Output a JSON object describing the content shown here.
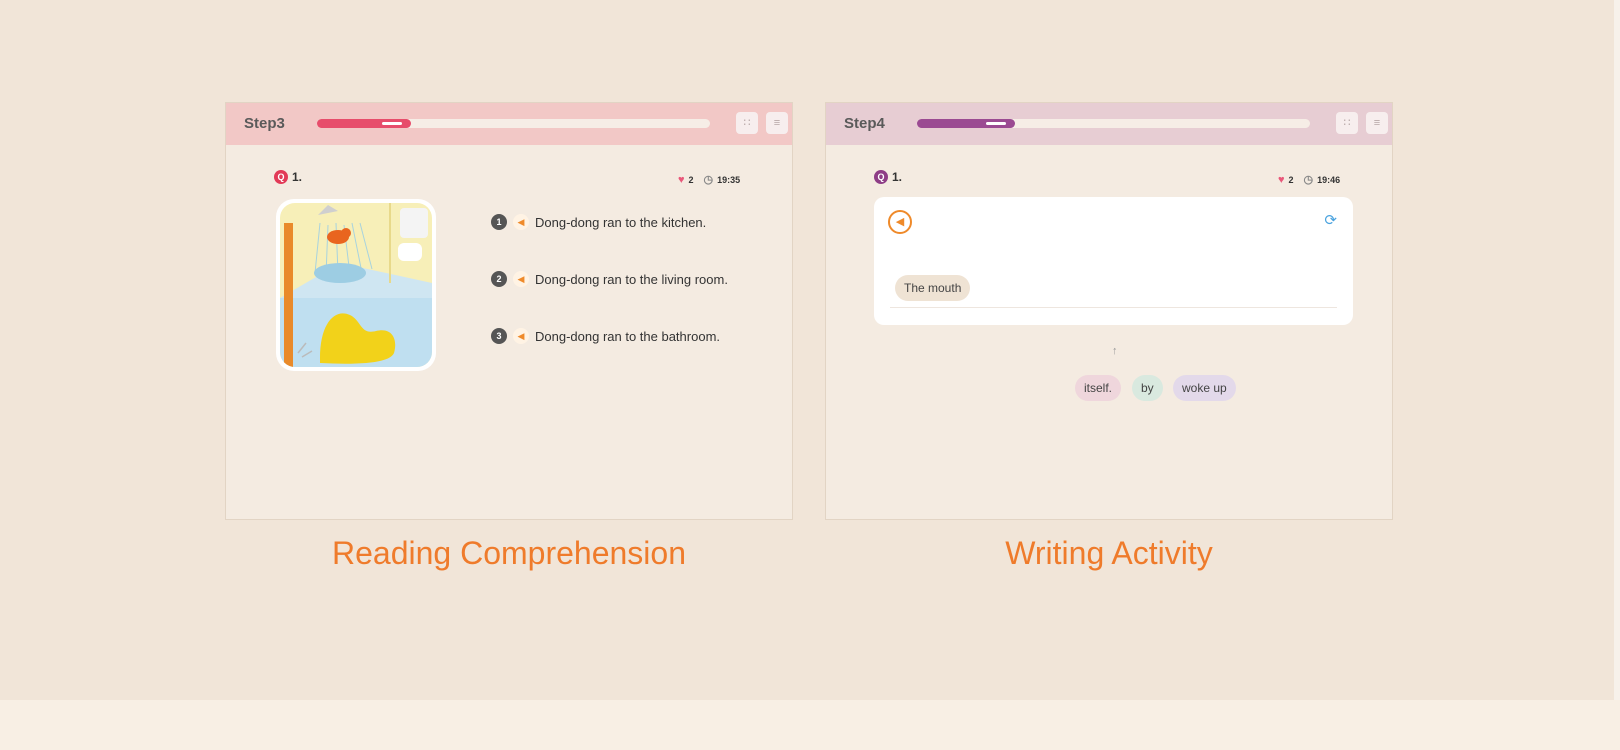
{
  "colors": {
    "background": "#f1e5d8",
    "caption": "#ef7b2b",
    "step3_accent": "#e74d6b",
    "step4_accent": "#9b4a92"
  },
  "reading": {
    "step_label": "Step3",
    "progress": 0.24,
    "question_number": "1.",
    "hearts": "2",
    "timer": "19:35",
    "picture": "bathroom-duck-illustration",
    "options": [
      {
        "num": "1",
        "text": "Dong-dong ran to the kitchen."
      },
      {
        "num": "2",
        "text": "Dong-dong ran to the living room."
      },
      {
        "num": "3",
        "text": "Dong-dong ran to the bathroom."
      }
    ],
    "caption": "Reading Comprehension"
  },
  "writing": {
    "step_label": "Step4",
    "progress": 0.25,
    "question_number": "1.",
    "hearts": "2",
    "timer": "19:46",
    "placed_words": [
      "The mouth"
    ],
    "word_bank": [
      "itself.",
      "by",
      "woke up"
    ],
    "caption": "Writing Activity"
  },
  "icons": {
    "question": "q-badge-icon",
    "heart": "heart-icon",
    "timer": "stopwatch-icon",
    "speaker": "speaker-icon",
    "refresh": "refresh-icon",
    "grid": "grid-icon",
    "menu": "menu-icon",
    "arrow": "up-arrow-icon"
  }
}
